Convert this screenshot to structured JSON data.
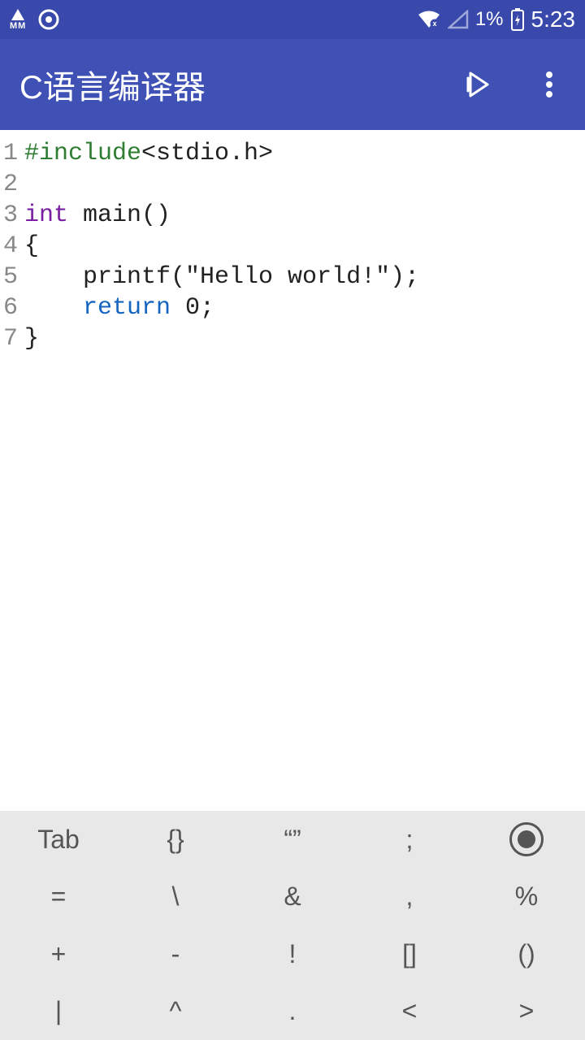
{
  "status": {
    "mm_label": "MM",
    "battery_pct": "1%",
    "time": "5:23"
  },
  "app": {
    "title": "C语言编译器"
  },
  "code": {
    "lines": [
      {
        "num": "1",
        "tokens": [
          {
            "cls": "tok-preproc",
            "text": "#include"
          },
          {
            "cls": "tok-plain",
            "text": "<stdio.h>"
          }
        ]
      },
      {
        "num": "2",
        "tokens": []
      },
      {
        "num": "3",
        "tokens": [
          {
            "cls": "tok-kw",
            "text": "int"
          },
          {
            "cls": "tok-plain",
            "text": " main()"
          }
        ]
      },
      {
        "num": "4",
        "tokens": [
          {
            "cls": "tok-plain",
            "text": "{"
          }
        ]
      },
      {
        "num": "5",
        "tokens": [
          {
            "cls": "tok-plain",
            "text": "    printf(\"Hello world!\");"
          }
        ]
      },
      {
        "num": "6",
        "tokens": [
          {
            "cls": "tok-plain",
            "text": "    "
          },
          {
            "cls": "tok-kw2",
            "text": "return"
          },
          {
            "cls": "tok-plain",
            "text": " 0;"
          }
        ]
      },
      {
        "num": "7",
        "tokens": [
          {
            "cls": "tok-plain",
            "text": "}"
          }
        ]
      }
    ]
  },
  "keyboard": {
    "rows": [
      [
        "Tab",
        "{}",
        "“”",
        ";",
        "◉"
      ],
      [
        "=",
        "\\",
        "&",
        ",",
        "%"
      ],
      [
        "+",
        "-",
        "!",
        "[]",
        "()"
      ],
      [
        "|",
        "^",
        ".",
        "<",
        ">"
      ]
    ]
  }
}
